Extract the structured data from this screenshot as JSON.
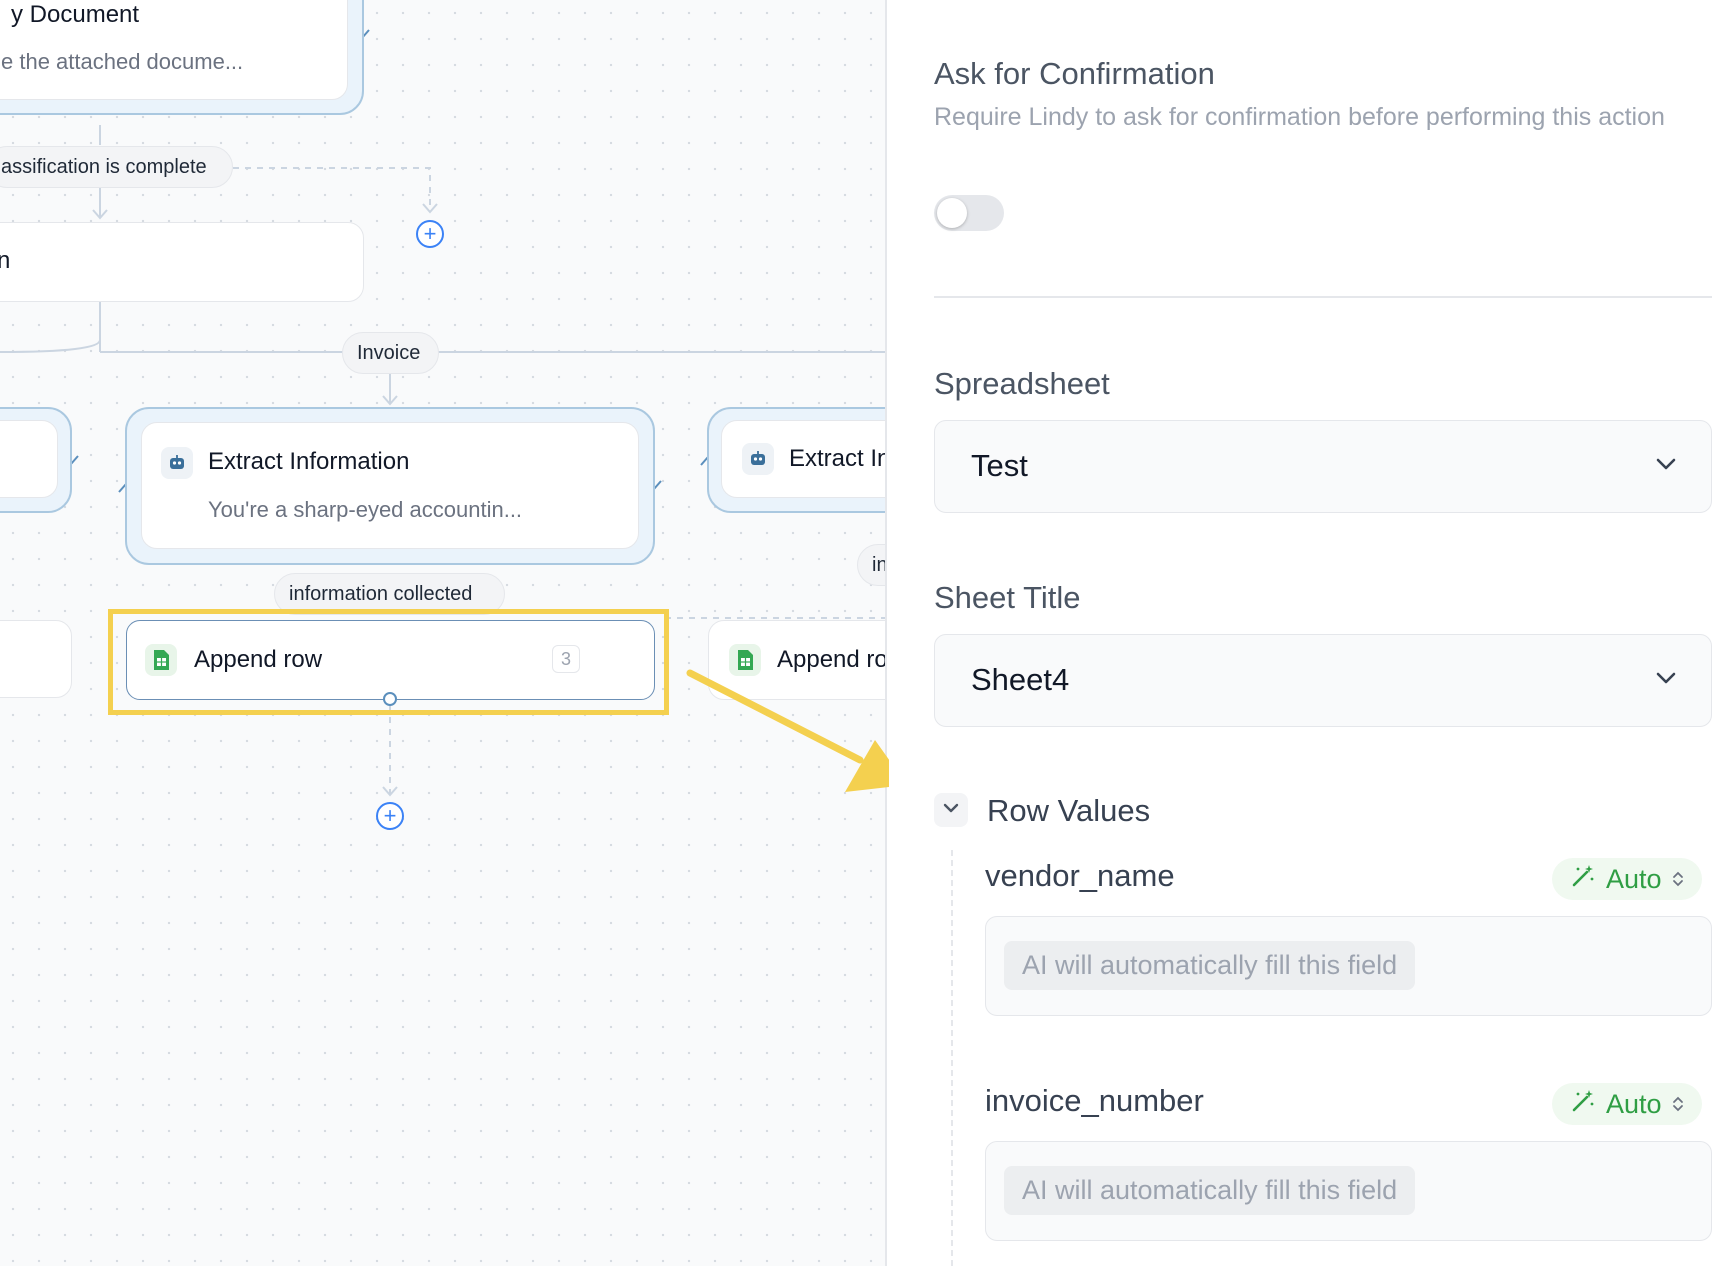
{
  "canvas": {
    "top_node": {
      "title": "y Document",
      "subtitle": "e the attached docume..."
    },
    "condition_pill": "assification is complete",
    "middle_node_title": "n",
    "branch_pill": "Invoice",
    "extract_node": {
      "title": "Extract Information",
      "subtitle": "You're a sharp-eyed accountin..."
    },
    "extract_node_right": {
      "title": "Extract In"
    },
    "info_pill": "information collected",
    "right_pill": "in",
    "append_node": {
      "title": "Append row",
      "count": "3"
    },
    "append_node_right": {
      "title": "Append ro"
    },
    "icons": {
      "agent": "robot-icon",
      "sheets": "google-sheets-icon",
      "add": "plus-circle-icon"
    },
    "colors": {
      "highlight": "#f4d04f",
      "accent": "#3b82f6",
      "loop": "#aac8e0"
    }
  },
  "panel": {
    "confirmation": {
      "title": "Ask for Confirmation",
      "description": "Require Lindy to ask for confirmation before performing this action",
      "enabled": false
    },
    "spreadsheet": {
      "label": "Spreadsheet",
      "value": "Test"
    },
    "sheet_title": {
      "label": "Sheet Title",
      "value": "Sheet4"
    },
    "row_values": {
      "label": "Row Values",
      "fields": [
        {
          "name": "vendor_name",
          "mode": "Auto",
          "placeholder": "AI will automatically fill this field"
        },
        {
          "name": "invoice_number",
          "mode": "Auto",
          "placeholder": "AI will automatically fill this field"
        }
      ]
    },
    "colors": {
      "auto": "#2f9e44"
    }
  }
}
